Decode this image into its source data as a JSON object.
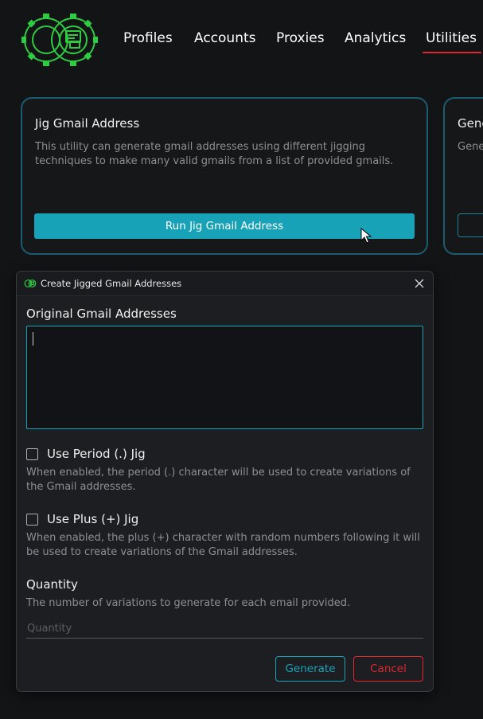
{
  "nav": {
    "items": [
      {
        "label": "Profiles",
        "active": false
      },
      {
        "label": "Accounts",
        "active": false
      },
      {
        "label": "Proxies",
        "active": false
      },
      {
        "label": "Analytics",
        "active": false
      },
      {
        "label": "Utilities",
        "active": true
      }
    ]
  },
  "cards": [
    {
      "title": "Jig Gmail Address",
      "description": "This utility can generate gmail addresses using different jigging techniques to make many valid gmails from a list of provided gmails.",
      "button_label": "Run Jig Gmail Address"
    },
    {
      "title": "Gene",
      "description": "Gene"
    }
  ],
  "dialog": {
    "title": "Create Jigged Gmail Addresses",
    "original_label": "Original Gmail Addresses",
    "original_value": "",
    "period_jig": {
      "label": "Use Period (.) Jig",
      "checked": false,
      "help": "When enabled, the period (.) character will be used to create variations of the Gmail addresses."
    },
    "plus_jig": {
      "label": "Use Plus (+) Jig",
      "checked": false,
      "help": "When enabled, the plus (+) character with random numbers following it will be used to create variations of the Gmail addresses."
    },
    "quantity": {
      "label": "Quantity",
      "help": "The number of variations to generate for each email provided.",
      "placeholder": "Quantity",
      "value": ""
    },
    "generate_label": "Generate",
    "cancel_label": "Cancel"
  },
  "colors": {
    "accent": "#17a2b8",
    "danger": "#e0262e",
    "logo": "#2ecc40",
    "background": "#131416"
  },
  "icons": {
    "logo": "gear-logo",
    "close": "close-icon",
    "cursor": "mouse-cursor"
  }
}
